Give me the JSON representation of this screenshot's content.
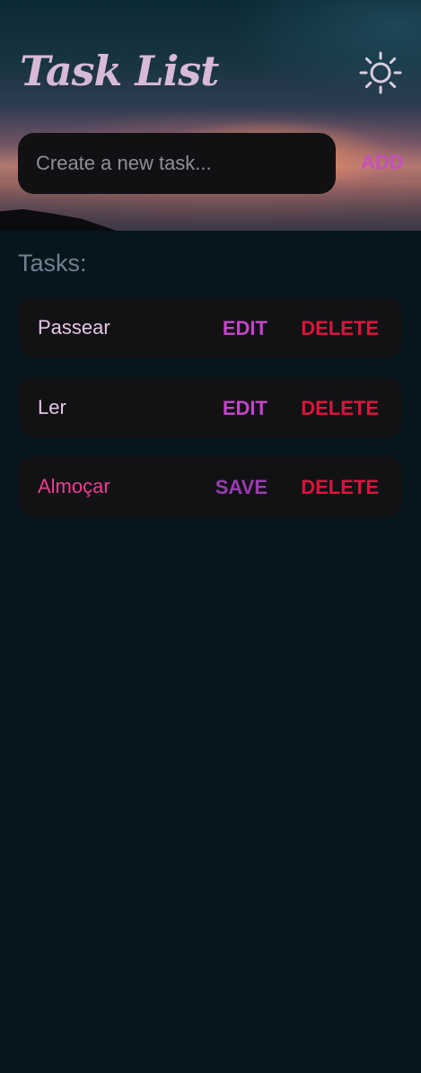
{
  "header": {
    "title": "Task List",
    "theme_icon": "sun-icon"
  },
  "new_task": {
    "placeholder": "Create a new task...",
    "value": "",
    "add_label": "ADD"
  },
  "tasks_heading": "Tasks:",
  "tasks": [
    {
      "name": "Passear",
      "state": "view",
      "primary_label": "EDIT",
      "delete_label": "DELETE"
    },
    {
      "name": "Ler",
      "state": "view",
      "primary_label": "EDIT",
      "delete_label": "DELETE"
    },
    {
      "name": "Almoçar",
      "state": "editing",
      "primary_label": "SAVE",
      "delete_label": "DELETE"
    }
  ],
  "colors": {
    "background": "#07151d",
    "title": "#d6bad6",
    "add": "#c64fbe",
    "edit": "#c346c8",
    "save": "#9a3cb0",
    "delete": "#dc143c",
    "editing_text": "#ee3d8f"
  }
}
